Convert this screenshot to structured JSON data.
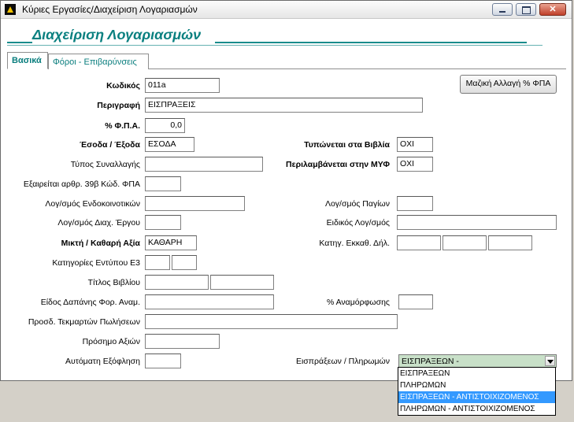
{
  "window": {
    "title": "Κύριες Εργασίες/Διαχείριση Λογαριασμών"
  },
  "header": {
    "title": "Διαχείριση Λογαριασμών"
  },
  "tabs": [
    {
      "label": "Βασικά"
    },
    {
      "label": "Φόροι - Επιβαρύνσεις"
    }
  ],
  "toolbar": {
    "vat_button": "Μαζική Αλλαγή % ΦΠΑ"
  },
  "form": {
    "code": {
      "label": "Κωδικός",
      "value": "011a"
    },
    "description": {
      "label": "Περιγραφή",
      "value": "ΕΙΣΠΡΑΞΕΙΣ"
    },
    "vat_pct": {
      "label": "% Φ.Π.Α.",
      "value": "0,0"
    },
    "income_expense": {
      "label": "Έσοδα / Έξοδα",
      "value": "ΕΣΟΔΑ"
    },
    "printed_in_books": {
      "label": "Τυπώνεται στα Βιβλία",
      "value": "ΟΧΙ"
    },
    "transaction_type": {
      "label": "Τύπος Συναλλαγής",
      "value": ""
    },
    "included_in_myf": {
      "label": "Περιλαμβάνεται στην ΜΥΦ",
      "value": "ΟΧΙ"
    },
    "exempt_39b": {
      "label": "Εξαιρείται αρθρ. 39β Κώδ. ΦΠΑ",
      "value": ""
    },
    "intra_community": {
      "label": "Λογ/σμός Ενδοκοινοτικών",
      "value": ""
    },
    "fixed_assets": {
      "label": "Λογ/σμός Παγίων",
      "value": ""
    },
    "project_mgmt": {
      "label": "Λογ/σμός Διαχ. Έργου",
      "value": ""
    },
    "special_account": {
      "label": "Ειδικός Λογ/σμός",
      "value": ""
    },
    "gross_net": {
      "label": "Μικτή  / Καθαρή Αξία",
      "value": "ΚΑΘΑΡΗ"
    },
    "clearance_category": {
      "label": "Κατηγ. Εκκαθ. Δήλ.",
      "values": [
        "",
        "",
        ""
      ]
    },
    "e3_categories": {
      "label": "Κατηγορίες Εντύπου Ε3",
      "values": [
        "",
        ""
      ]
    },
    "book_title": {
      "label": "Τίτλος Βιβλίου",
      "values": [
        "",
        ""
      ]
    },
    "expense_type": {
      "label": "Είδος Δαπάνης Φορ. Αναμ.",
      "value": ""
    },
    "restatement_pct": {
      "label": "% Αναμόρφωσης",
      "value": ""
    },
    "sales_evidence": {
      "label": "Προσδ. Τεκμαρτών Πωλήσεων",
      "value": ""
    },
    "value_sign": {
      "label": "Πρόσημο Αξιών",
      "value": ""
    },
    "auto_settlement": {
      "label": "Αυτόματη Εξόφληση",
      "value": ""
    },
    "receipts_payments": {
      "label": "Εισπράξεων / Πληρωμών",
      "value": "ΕΙΣΠΡΑΞΕΩΝ -",
      "options": [
        "ΕΙΣΠΡΑΞΕΩΝ",
        "ΠΛΗΡΩΜΩΝ",
        "ΕΙΣΠΡΑΞΕΩΝ - ΑΝΤΙΣΤΟΙΧΙΖΟΜΕΝΟΣ",
        "ΠΛΗΡΩΜΩΝ - ΑΝΤΙΣΤΟΙΧΙΖΟΜΕΝΟΣ"
      ],
      "selected_option": "ΕΙΣΠΡΑΞΕΩΝ - ΑΝΤΙΣΤΟΙΧΙΖΟΜΕΝΟΣ"
    }
  }
}
